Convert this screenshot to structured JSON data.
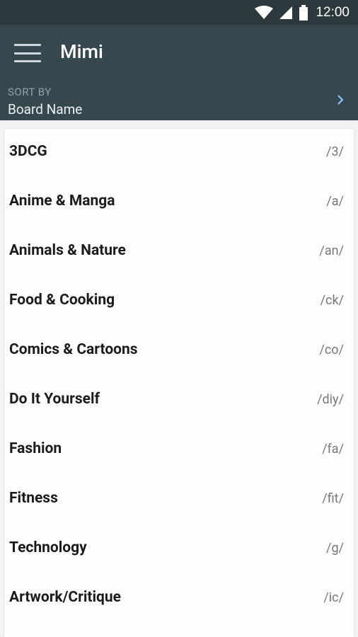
{
  "status": {
    "time": "12:00"
  },
  "appbar": {
    "title": "Mimi",
    "sort_label": "SORT BY",
    "sort_value": "Board Name"
  },
  "boards": [
    {
      "name": "3DCG",
      "code": "/3/"
    },
    {
      "name": "Anime & Manga",
      "code": "/a/"
    },
    {
      "name": "Animals & Nature",
      "code": "/an/"
    },
    {
      "name": "Food & Cooking",
      "code": "/ck/"
    },
    {
      "name": "Comics & Cartoons",
      "code": "/co/"
    },
    {
      "name": "Do It Yourself",
      "code": "/diy/"
    },
    {
      "name": "Fashion",
      "code": "/fa/"
    },
    {
      "name": "Fitness",
      "code": "/fit/"
    },
    {
      "name": "Technology",
      "code": "/g/"
    },
    {
      "name": "Artwork/Critique",
      "code": "/ic/"
    }
  ],
  "icons": {
    "wifi": "wifi-icon",
    "signal": "signal-icon",
    "battery": "battery-icon",
    "menu": "hamburger-menu-icon",
    "chevron": "chevron-right-icon"
  },
  "colors": {
    "status_bar": "#2c383d",
    "app_bar": "#37474f",
    "accent_label": "#90a4ae"
  }
}
